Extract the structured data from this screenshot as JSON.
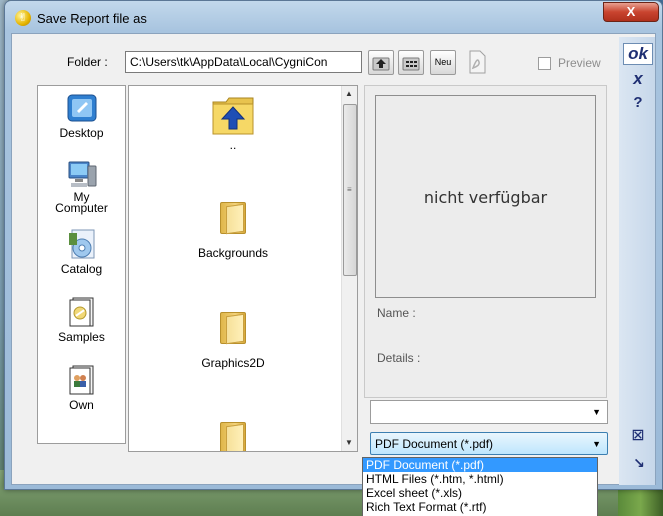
{
  "window": {
    "title": "Save Report file as",
    "close_label": "X"
  },
  "folder": {
    "label": "Folder :",
    "path": "C:\\Users\\tk\\AppData\\Local\\CygniCon"
  },
  "toolbar": {
    "new_folder_label": "Neu",
    "preview_label": "Preview",
    "preview_checked": false
  },
  "places": [
    {
      "label": "Desktop",
      "icon": "desktop-icon"
    },
    {
      "label": "My\nComputer",
      "icon": "computer-icon"
    },
    {
      "label": "Catalog",
      "icon": "catalog-icon"
    },
    {
      "label": "Samples",
      "icon": "samples-icon"
    },
    {
      "label": "Own",
      "icon": "own-icon"
    }
  ],
  "files": [
    {
      "label": "..",
      "icon": "up-folder-icon"
    },
    {
      "label": "Backgrounds",
      "icon": "folder-icon"
    },
    {
      "label": "Graphics2D",
      "icon": "folder-icon"
    },
    {
      "label": "",
      "icon": "folder-icon"
    }
  ],
  "preview": {
    "placeholder": "nicht verfügbar",
    "name_label": "Name :",
    "details_label": "Details :"
  },
  "file_type": {
    "selected": "PDF Document (*.pdf)",
    "options": [
      "PDF Document (*.pdf)",
      "HTML Files (*.htm, *.html)",
      "Excel sheet (*.xls)",
      "Rich Text Format (*.rtf)"
    ]
  },
  "commands": {
    "ok_label": "ok",
    "cancel_label": "x",
    "help_label": "?"
  },
  "colors": {
    "command_text": "#1f2f73",
    "selection": "#3399ff"
  }
}
